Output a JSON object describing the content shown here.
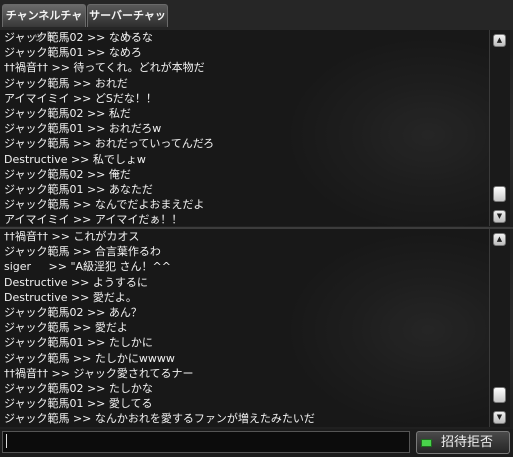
{
  "tabs": [
    {
      "label": "チャンネルチャット",
      "active": true
    },
    {
      "label": "サーバーチャット",
      "active": false
    }
  ],
  "upper_chat": {
    "messages": [
      "ジャック範馬02 >> なめるな",
      "ジャック範馬01 >> なめろ",
      "††禍音†† >> 待ってくれ。どれが本物だ",
      "ジャック範馬 >> おれだ",
      "アイマイミイ >> どSだな！！",
      "ジャック範馬02 >> 私だ",
      "ジャック範馬01 >> おれだろw",
      "ジャック範馬 >> おれだっていってんだろ",
      "Destructive >> 私でしょw",
      "ジャック範馬02 >> 俺だ",
      "ジャック範馬01 >> あなただ",
      "ジャック範馬 >> なんでだよおまえだよ",
      "アイマイミイ >> アイマイだぁ！！"
    ]
  },
  "lower_chat": {
    "messages": [
      "††禍音†† >> これがカオス",
      "ジャック範馬 >> 合言葉作るわ",
      "siger     >> \"A級淫犯 さん！^^",
      "Destructive >> ようするに",
      "Destructive >> 愛だよ。",
      "ジャック範馬02 >> あん？",
      "ジャック範馬 >> 愛だよ",
      "ジャック範馬01 >> たしかに",
      "ジャック範馬 >> たしかにwwww",
      "††禍音†† >> ジャック愛されてるナー",
      "ジャック範馬02 >> たしかな",
      "ジャック範馬01 >> 愛してる",
      "ジャック範馬 >> なんかおれを愛するファンが増えたみたいだ"
    ]
  },
  "input": {
    "value": "",
    "placeholder": ""
  },
  "invite_button": {
    "label": "招待拒否",
    "indicator_color": "#49d24b"
  },
  "icons": {
    "scroll_up": "up-arrow-icon",
    "scroll_down": "down-arrow-icon"
  }
}
